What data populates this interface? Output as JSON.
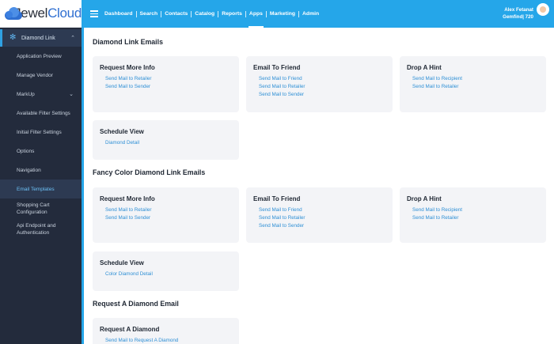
{
  "brand": {
    "name_part1": "Jewel",
    "name_part2": "Cloud"
  },
  "sidebar": {
    "parent_label": "Diamond Link",
    "items": [
      {
        "label": "Application Preview"
      },
      {
        "label": "Manage Vendor"
      },
      {
        "label": "MarkUp"
      },
      {
        "label": "Available Filter Settings"
      },
      {
        "label": "Initial Filter Settings"
      },
      {
        "label": "Options"
      },
      {
        "label": "Navigation"
      },
      {
        "label": "Email Templates"
      },
      {
        "label": "Shopping Cart Configuration"
      },
      {
        "label": "Api Endpoint and Authentication"
      }
    ]
  },
  "topnav": {
    "items": [
      "Dashboard",
      "Search",
      "Contacts",
      "Catalog",
      "Reports",
      "Apps",
      "Marketing",
      "Admin"
    ],
    "active": "Apps"
  },
  "user": {
    "name": "Alex Fetanat",
    "company": "Gemfind| 720"
  },
  "sections": [
    {
      "title": "Diamond Link Emails",
      "cards": [
        {
          "title": "Request More Info",
          "links": [
            "Send Mail to Retailer",
            "Send Mail to Sender"
          ]
        },
        {
          "title": "Email To Friend",
          "links": [
            "Send Mail to Friend",
            "Send Mail to Retailer",
            "Send Mail to Sender"
          ]
        },
        {
          "title": "Drop A Hint",
          "links": [
            "Send Mail to Recipient",
            "Send Mail to Retailer"
          ]
        },
        {
          "title": "Schedule View",
          "links": [
            "Diamond Detail"
          ]
        }
      ]
    },
    {
      "title": "Fancy Color Diamond Link Emails",
      "cards": [
        {
          "title": "Request More Info",
          "links": [
            "Send Mail to Retailer",
            "Send Mail to Sender"
          ]
        },
        {
          "title": "Email To Friend",
          "links": [
            "Send Mail to Friend",
            "Send Mail to Retailer",
            "Send Mail to Sender"
          ]
        },
        {
          "title": "Drop A Hint",
          "links": [
            "Send Mail to Recipient",
            "Send Mail to Retailer"
          ]
        },
        {
          "title": "Schedule View",
          "links": [
            "Color Diamond Detail"
          ]
        }
      ]
    },
    {
      "title": "Request A Diamond Email",
      "cards": [
        {
          "title": "Request A Diamond",
          "links": [
            "Send Mail to Request A Diamond"
          ]
        }
      ]
    }
  ],
  "colors": {
    "topbar": "#25a6e9",
    "sidebar": "#232b3c",
    "link": "#2e8fd5",
    "card": "#f3f4f7"
  }
}
